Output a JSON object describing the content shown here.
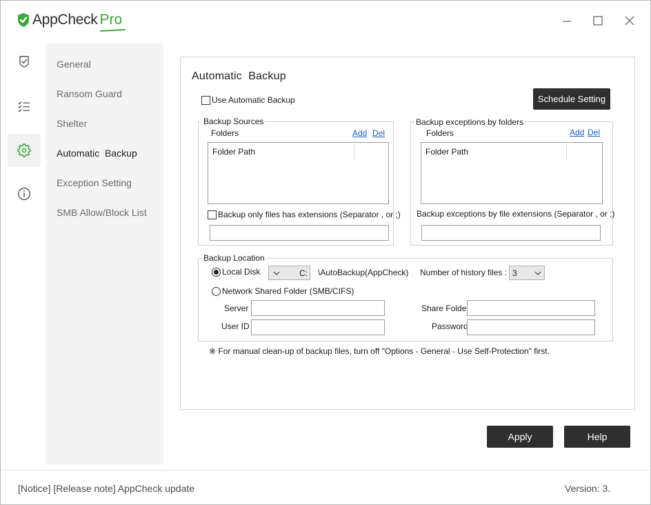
{
  "app": {
    "name": "AppCheck",
    "edition": "Pro"
  },
  "rail": {
    "items": [
      {
        "icon": "shield-check-icon"
      },
      {
        "icon": "checklist-icon"
      },
      {
        "icon": "gear-icon"
      },
      {
        "icon": "info-icon"
      }
    ],
    "accent": "#3aa83a"
  },
  "menu": {
    "items": [
      {
        "label": "General"
      },
      {
        "label": "Ransom Guard"
      },
      {
        "label": "Shelter"
      },
      {
        "label": "Automatic  Backup"
      },
      {
        "label": "Exception Setting"
      },
      {
        "label": "SMB Allow/Block List"
      }
    ],
    "active": "Automatic  Backup"
  },
  "page": {
    "title": "Automatic  Backup",
    "use_auto_backup_label": "Use Automatic Backup",
    "use_auto_backup_checked": false,
    "schedule_button": "Schedule Setting"
  },
  "sources": {
    "legend": "Backup Sources",
    "folders_label": "Folders",
    "add": "Add",
    "del": "Del",
    "column": "Folder Path",
    "ext_checkbox_label": "Backup only files has extensions (Separator , or ;)",
    "ext_checked": false,
    "ext_value": ""
  },
  "exceptions": {
    "legend": "Backup exceptions by folders",
    "folders_label": "Folders",
    "add": "Add",
    "del": "Del",
    "column": "Folder Path",
    "ext_label": "Backup exceptions by file extensions (Separator , or ;)",
    "ext_value": ""
  },
  "location": {
    "legend": "Backup Location",
    "local_disk_label": "Local Disk",
    "local_disk_selected": true,
    "drive": "C:",
    "path": "\\AutoBackup(AppCheck)",
    "history_label": "Number of history files :",
    "history_value": "3",
    "network_label": "Network Shared Folder (SMB/CIFS)",
    "network_selected": false,
    "server_label": "Server",
    "server_value": "",
    "share_label": "Share Folder",
    "share_value": "",
    "userid_label": "User ID",
    "userid_value": "",
    "password_label": "Password",
    "password_value": ""
  },
  "note": "※ For manual clean-up of backup files, turn off \"Options - General - Use Self-Protection\" first.",
  "buttons": {
    "apply": "Apply",
    "help": "Help"
  },
  "footer": {
    "notice": "[Notice] [Release note] AppCheck update",
    "version": "Version: 3."
  }
}
